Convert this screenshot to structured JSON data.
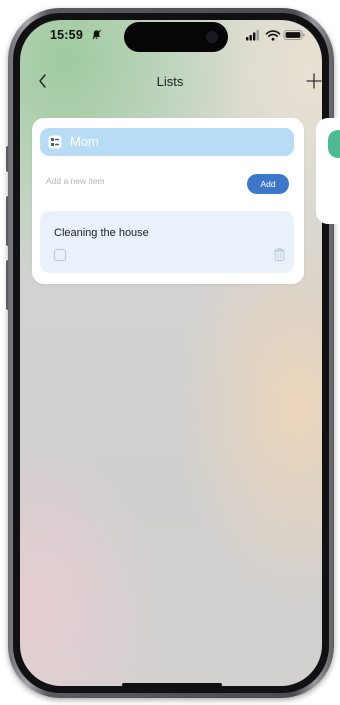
{
  "status_bar": {
    "time": "15:59",
    "icons": [
      "bell-muted-icon",
      "signal-icon",
      "wifi-icon",
      "battery-icon"
    ]
  },
  "nav": {
    "title": "Lists",
    "back_icon": "chevron-left-icon",
    "add_icon": "plus-icon"
  },
  "list_card": {
    "title": "Mom",
    "icon": "list-icon",
    "header_color": "#b9dcf6",
    "add_item_placeholder": "Add a new item",
    "add_button_label": "Add",
    "add_button_color": "#3f77c8",
    "items": [
      {
        "title": "Cleaning the house",
        "checked": false
      }
    ]
  },
  "next_card": {
    "accent_color": "#4dbb8f"
  }
}
